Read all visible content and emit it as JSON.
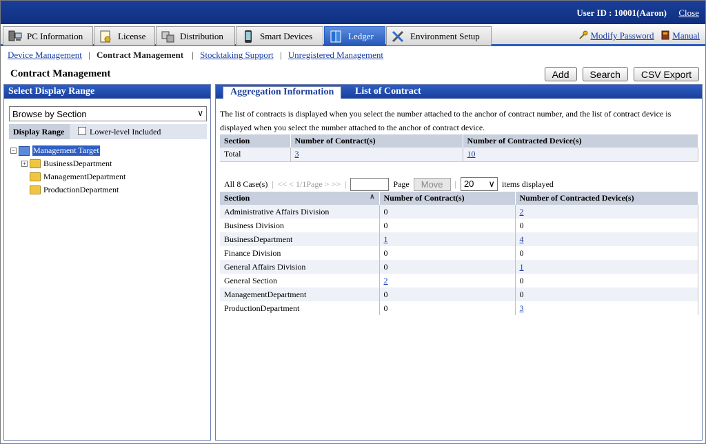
{
  "topbar": {
    "user_label": "User ID : 10001(Aaron)",
    "close_label": "Close"
  },
  "tabs": [
    {
      "label": "PC Information",
      "icon": "pc-icon",
      "active": false
    },
    {
      "label": "License",
      "icon": "license-icon",
      "active": false
    },
    {
      "label": "Distribution",
      "icon": "distribution-icon",
      "active": false
    },
    {
      "label": "Smart Devices",
      "icon": "smartphone-icon",
      "active": false
    },
    {
      "label": "Ledger",
      "icon": "ledger-icon",
      "active": true
    },
    {
      "label": "Environment Setup",
      "icon": "tools-icon",
      "active": false
    }
  ],
  "tab_links": {
    "modify_password": "Modify Password",
    "manual": "Manual"
  },
  "subnav": {
    "device_management": "Device Management",
    "contract_management": "Contract Management",
    "stocktaking_support": "Stocktaking Support",
    "unregistered_management": "Unregistered Management"
  },
  "page_title": "Contract Management",
  "actions": {
    "add": "Add",
    "search": "Search",
    "csv_export": "CSV Export"
  },
  "left": {
    "title": "Select Display Range",
    "browse_select": "Browse by Section",
    "display_range_label": "Display Range",
    "lower_level_label": "Lower-level Included",
    "tree": {
      "root": "Management Target",
      "children": [
        "BusinessDepartment",
        "ManagementDepartment",
        "ProductionDepartment"
      ]
    }
  },
  "right": {
    "tab_active": "Aggregation Information",
    "tab_inactive": "List of Contract",
    "info": "The list of contracts is displayed when you select the number attached to the anchor of contract number, and the list of contract device is displayed when you select the number attached to the anchor of contract device.",
    "agg_headers": [
      "Section",
      "Number of Contract(s)",
      "Number of Contracted Device(s)"
    ],
    "agg_row": [
      "Total",
      "3",
      "10"
    ],
    "pager": {
      "count": "All 8 Case(s)",
      "nav": "<< < 1/1Page > >>",
      "page_label": "Page",
      "move": "Move",
      "size": "20",
      "items_label": "items displayed"
    },
    "list_headers": [
      "Section",
      "Number of Contract(s)",
      "Number of Contracted Device(s)"
    ],
    "rows": [
      [
        "Administrative Affairs Division",
        "0",
        "2"
      ],
      [
        "Business Division",
        "0",
        "0"
      ],
      [
        "BusinessDepartment",
        "1",
        "4"
      ],
      [
        "Finance Division",
        "0",
        "0"
      ],
      [
        "General Affairs Division",
        "0",
        "1"
      ],
      [
        "General Section",
        "2",
        "0"
      ],
      [
        "ManagementDepartment",
        "0",
        "0"
      ],
      [
        "ProductionDepartment",
        "0",
        "3"
      ]
    ],
    "link_flags": [
      [
        false,
        true
      ],
      [
        false,
        false
      ],
      [
        true,
        true
      ],
      [
        false,
        false
      ],
      [
        false,
        true
      ],
      [
        true,
        false
      ],
      [
        false,
        false
      ],
      [
        false,
        true
      ]
    ]
  }
}
